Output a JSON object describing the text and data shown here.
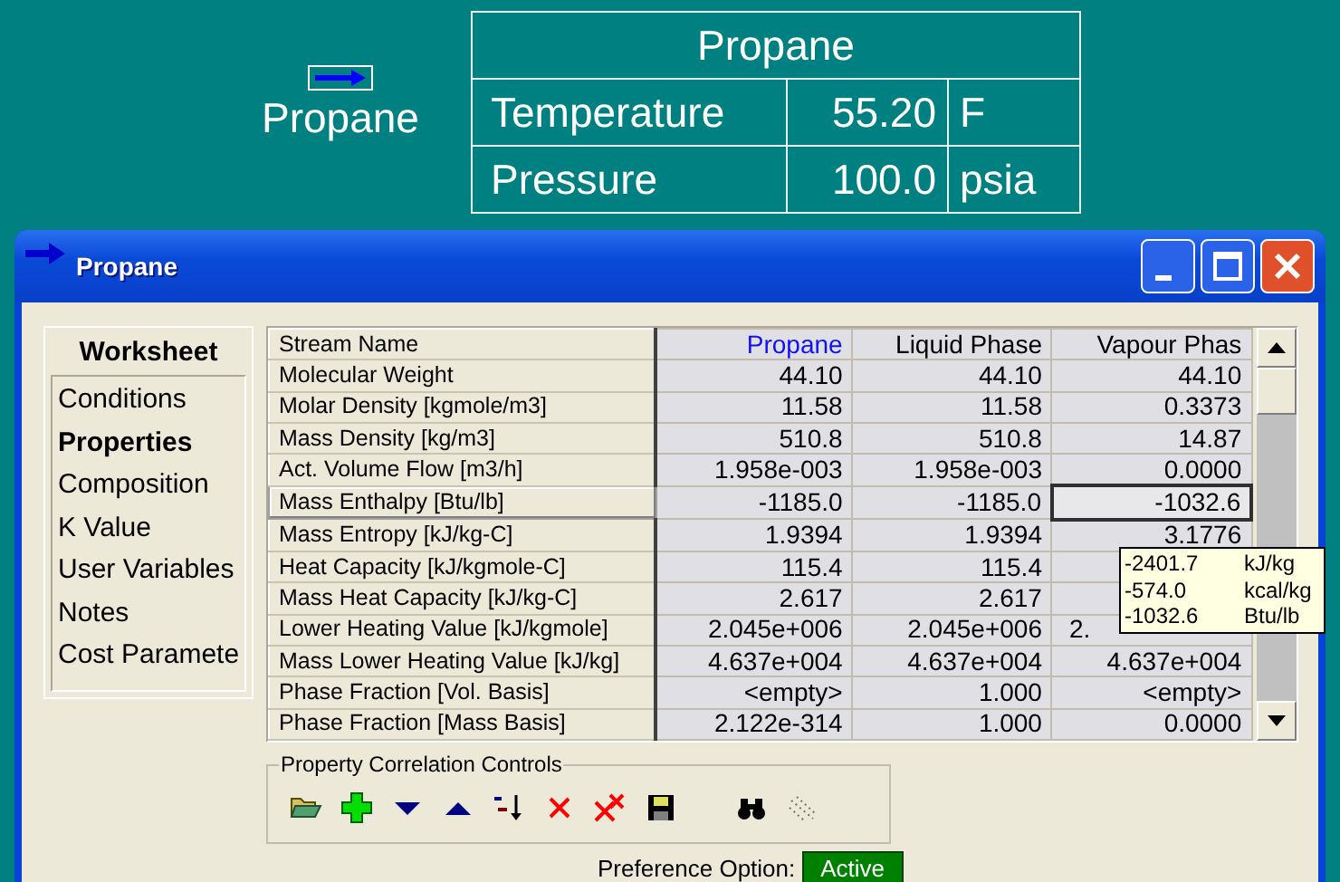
{
  "stream_label": {
    "name": "Propane"
  },
  "stream_table": {
    "title": "Propane",
    "rows": [
      {
        "property": "Temperature",
        "value": "55.20",
        "unit": "F"
      },
      {
        "property": "Pressure",
        "value": "100.0",
        "unit": "psia"
      }
    ]
  },
  "window": {
    "title": "Propane"
  },
  "sidebar": {
    "header": "Worksheet",
    "items": [
      {
        "label": "Conditions",
        "selected": false
      },
      {
        "label": "Properties",
        "selected": true
      },
      {
        "label": "Composition",
        "selected": false
      },
      {
        "label": "K Value",
        "selected": false
      },
      {
        "label": "User Variables",
        "selected": false
      },
      {
        "label": "Notes",
        "selected": false
      },
      {
        "label": "Cost Paramete",
        "selected": false
      }
    ]
  },
  "grid": {
    "columns": [
      {
        "title": "Stream Name",
        "kind": "label"
      },
      {
        "title": "Propane",
        "kind": "stream"
      },
      {
        "title": "Liquid Phase",
        "kind": "phase"
      },
      {
        "title": "Vapour Phas",
        "kind": "phase"
      }
    ],
    "rows": [
      {
        "label": "Molecular Weight",
        "selected": false,
        "values": [
          {
            "text": "44.10",
            "selected": false
          },
          {
            "text": "44.10",
            "selected": false
          },
          {
            "text": "44.10",
            "selected": false
          }
        ]
      },
      {
        "label": "Molar Density [kgmole/m3]",
        "selected": false,
        "values": [
          {
            "text": "11.58",
            "selected": false
          },
          {
            "text": "11.58",
            "selected": false
          },
          {
            "text": "0.3373",
            "selected": false
          }
        ]
      },
      {
        "label": "Mass Density [kg/m3]",
        "selected": false,
        "values": [
          {
            "text": "510.8",
            "selected": false
          },
          {
            "text": "510.8",
            "selected": false
          },
          {
            "text": "14.87",
            "selected": false
          }
        ]
      },
      {
        "label": "Act. Volume Flow [m3/h]",
        "selected": false,
        "values": [
          {
            "text": "1.958e-003",
            "selected": false
          },
          {
            "text": "1.958e-003",
            "selected": false
          },
          {
            "text": "0.0000",
            "selected": false
          }
        ]
      },
      {
        "label": "Mass Enthalpy [Btu/lb]",
        "selected": true,
        "values": [
          {
            "text": "-1185.0",
            "selected": false
          },
          {
            "text": "-1185.0",
            "selected": false
          },
          {
            "text": "-1032.6",
            "selected": true
          }
        ]
      },
      {
        "label": "Mass Entropy [kJ/kg-C]",
        "selected": false,
        "values": [
          {
            "text": "1.9394",
            "selected": false
          },
          {
            "text": "1.9394",
            "selected": false
          },
          {
            "text": "3.1776",
            "selected": false
          }
        ]
      },
      {
        "label": "Heat Capacity [kJ/kgmole-C]",
        "selected": false,
        "values": [
          {
            "text": "115.4",
            "selected": false
          },
          {
            "text": "115.4",
            "selected": false
          },
          {
            "selected": false
          }
        ]
      },
      {
        "label": "Mass Heat Capacity [kJ/kg-C]",
        "selected": false,
        "values": [
          {
            "text": "2.617",
            "selected": false
          },
          {
            "text": "2.617",
            "selected": false
          },
          {
            "selected": false
          }
        ]
      },
      {
        "label": "Lower Heating Value [kJ/kgmole]",
        "selected": false,
        "values": [
          {
            "text": "2.045e+006",
            "selected": false
          },
          {
            "text": "2.045e+006",
            "selected": false
          },
          {
            "text": "2.",
            "selected": false,
            "kind": "partial"
          }
        ]
      },
      {
        "label": "Mass Lower Heating Value [kJ/kg]",
        "selected": false,
        "values": [
          {
            "text": "4.637e+004",
            "selected": false
          },
          {
            "text": "4.637e+004",
            "selected": false
          },
          {
            "text": "4.637e+004",
            "selected": false
          }
        ]
      },
      {
        "label": "Phase Fraction [Vol. Basis]",
        "selected": false,
        "values": [
          {
            "text": "<empty>",
            "selected": false
          },
          {
            "text": "1.000",
            "selected": false
          },
          {
            "text": "<empty>",
            "selected": false
          }
        ]
      },
      {
        "label": "Phase Fraction [Mass Basis]",
        "selected": false,
        "values": [
          {
            "text": "2.122e-314",
            "selected": false
          },
          {
            "text": "1.000",
            "selected": false
          },
          {
            "text": "0.0000",
            "selected": false
          }
        ]
      }
    ]
  },
  "tooltip": {
    "lines": [
      {
        "value": "-2401.7",
        "unit": "kJ/kg"
      },
      {
        "value": "-574.0",
        "unit": "kcal/kg"
      },
      {
        "value": "-1032.6",
        "unit": "Btu/lb"
      }
    ]
  },
  "correlation_controls": {
    "title": "Property Correlation Controls",
    "tools": [
      {
        "kind": "open"
      },
      {
        "kind": "add"
      },
      {
        "kind": "down"
      },
      {
        "kind": "up"
      },
      {
        "kind": "sort"
      },
      {
        "kind": "delete"
      },
      {
        "kind": "delete_all"
      },
      {
        "kind": "save"
      },
      {
        "kind": "gap"
      },
      {
        "kind": "find"
      },
      {
        "kind": "scatter"
      }
    ]
  },
  "preference": {
    "label": "Preference Option:",
    "value": "Active"
  }
}
